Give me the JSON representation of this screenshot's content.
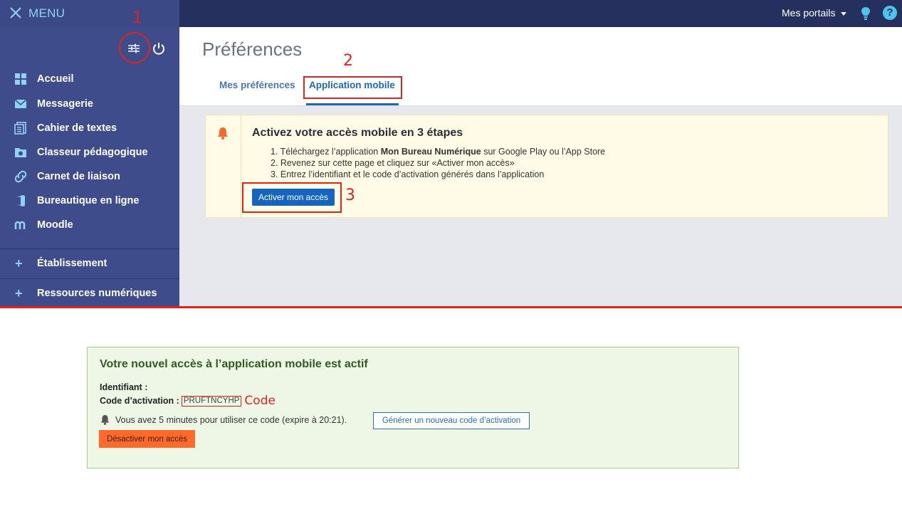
{
  "header": {
    "menu_label": "MENU",
    "portals_label": "Mes portails",
    "help_symbol": "?"
  },
  "sidebar": {
    "items": [
      {
        "label": "Accueil",
        "icon": "grid-icon"
      },
      {
        "label": "Messagerie",
        "icon": "envelope-icon"
      },
      {
        "label": "Cahier de textes",
        "icon": "notebook-icon"
      },
      {
        "label": "Classeur pédagogique",
        "icon": "folder-icon"
      },
      {
        "label": "Carnet de liaison",
        "icon": "link-icon"
      },
      {
        "label": "Bureautique en ligne",
        "icon": "office-icon"
      },
      {
        "label": "Moodle",
        "icon": "moodle-icon"
      }
    ],
    "sections": [
      {
        "label": "Établissement",
        "icon": "plus-icon"
      },
      {
        "label": "Ressources numériques",
        "icon": "plus-icon"
      }
    ]
  },
  "page": {
    "title": "Préférences",
    "tabs": [
      {
        "label": "Mes préférences",
        "active": false
      },
      {
        "label": "Application mobile",
        "active": true
      }
    ]
  },
  "alert": {
    "title": "Activez votre accès mobile en 3 étapes",
    "step1_prefix": "1. Téléchargez l’application ",
    "step1_bold": "Mon Bureau Numérique",
    "step1_suffix": " sur Google Play ou l’App Store",
    "step2": "2. Revenez sur cette page et cliquez sur «Activer mon accès»",
    "step3": "3. Entrez l’identifiant et le code d’activation générés dans l’application",
    "button": "Activer mon accès"
  },
  "annotations": {
    "n1": "1",
    "n2": "2",
    "n3": "3",
    "code": "Code"
  },
  "success": {
    "title": "Votre nouvel accès à l’application mobile est actif",
    "id_label": "Identifiant :",
    "code_label": "Code d’activation :",
    "code_value": "PRUFTNCYHP",
    "expire_text": "Vous avez 5 minutes pour utiliser ce code (expire à 20:21).",
    "new_code_button": "Générer un nouveau code d’activation",
    "deactivate_button": "Désactiver mon accès"
  },
  "colors": {
    "topbar": "#25305f",
    "sidebar": "#3f4c8c",
    "accent_blue": "#1565c0",
    "annotation_red": "#e2231a",
    "deactivate_orange": "#ff6a2b"
  }
}
